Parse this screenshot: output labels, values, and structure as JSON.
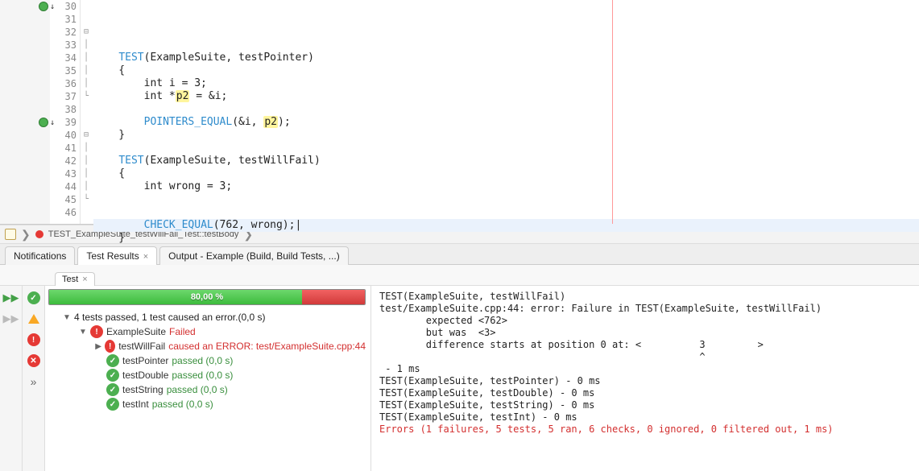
{
  "editor": {
    "lines": [
      {
        "num": 30,
        "marker": true,
        "arrow": true,
        "fold": "",
        "html": ""
      },
      {
        "num": 31,
        "fold": "",
        "segs": [
          {
            "t": "    "
          },
          {
            "t": "TEST",
            "c": "kw-macro"
          },
          {
            "t": "(ExampleSuite, testPointer)"
          }
        ]
      },
      {
        "num": 32,
        "fold": "⊟",
        "segs": [
          {
            "t": "    {"
          }
        ]
      },
      {
        "num": 33,
        "fold": "│",
        "segs": [
          {
            "t": "        int i = 3;"
          }
        ]
      },
      {
        "num": 34,
        "fold": "│",
        "segs": [
          {
            "t": "        int *"
          },
          {
            "t": "p2",
            "c": "hl-var"
          },
          {
            "t": " = &i;"
          }
        ]
      },
      {
        "num": 35,
        "fold": "│",
        "segs": [
          {
            "t": ""
          }
        ]
      },
      {
        "num": 36,
        "fold": "│",
        "segs": [
          {
            "t": "        "
          },
          {
            "t": "POINTERS_EQUAL",
            "c": "kw-macro"
          },
          {
            "t": "(&i, "
          },
          {
            "t": "p2",
            "c": "hl-var"
          },
          {
            "t": ");"
          }
        ]
      },
      {
        "num": 37,
        "fold": "└",
        "segs": [
          {
            "t": "    }"
          }
        ]
      },
      {
        "num": 38,
        "fold": "",
        "segs": [
          {
            "t": ""
          }
        ]
      },
      {
        "num": 39,
        "marker": true,
        "arrow": true,
        "fold": "",
        "segs": [
          {
            "t": "    "
          },
          {
            "t": "TEST",
            "c": "kw-macro"
          },
          {
            "t": "(ExampleSuite, testWillFail)"
          }
        ]
      },
      {
        "num": 40,
        "fold": "⊟",
        "segs": [
          {
            "t": "    {"
          }
        ]
      },
      {
        "num": 41,
        "fold": "│",
        "segs": [
          {
            "t": "        int wrong = 3;"
          }
        ]
      },
      {
        "num": 42,
        "fold": "│",
        "segs": [
          {
            "t": ""
          }
        ]
      },
      {
        "num": 43,
        "fold": "│",
        "segs": [
          {
            "t": ""
          }
        ]
      },
      {
        "num": 44,
        "fold": "│",
        "cursor": true,
        "segs": [
          {
            "t": "        "
          },
          {
            "t": "CHECK_EQUAL",
            "c": "kw-macro"
          },
          {
            "t": "(762, wrong);|"
          }
        ]
      },
      {
        "num": 45,
        "fold": "└",
        "segs": [
          {
            "t": "    }"
          }
        ]
      },
      {
        "num": 46,
        "fold": "",
        "segs": [
          {
            "t": ""
          }
        ]
      }
    ]
  },
  "breadcrumb": {
    "item": "TEST_ExampleSuite_testWillFail_Test::testBody"
  },
  "tabs": {
    "notifications": "Notifications",
    "test_results": "Test Results",
    "output": "Output - Example (Build, Build Tests, ...)"
  },
  "inner_tab": "Test",
  "progress": {
    "percent": "80,00 %",
    "green_pct": 80
  },
  "summary_line": "4 tests passed, 1 test caused an error.(0,0 s)",
  "tree": {
    "root": {
      "name": "ExampleSuite",
      "status": "Failed",
      "status_class": "st-fail"
    },
    "children": [
      {
        "name": "testWillFail",
        "status": "caused an ERROR: test/ExampleSuite.cpp:44",
        "status_class": "st-fail",
        "icon": "err",
        "tw": "▶"
      },
      {
        "name": "testPointer",
        "status": "passed  (0,0 s)",
        "status_class": "st-pass",
        "icon": "ok"
      },
      {
        "name": "testDouble",
        "status": "passed  (0,0 s)",
        "status_class": "st-pass",
        "icon": "ok"
      },
      {
        "name": "testString",
        "status": "passed  (0,0 s)",
        "status_class": "st-pass",
        "icon": "ok"
      },
      {
        "name": "testInt",
        "status": "passed  (0,0 s)",
        "status_class": "st-pass",
        "icon": "ok"
      }
    ]
  },
  "console": {
    "lines": [
      "TEST(ExampleSuite, testWillFail)",
      "test/ExampleSuite.cpp:44: error: Failure in TEST(ExampleSuite, testWillFail)",
      "        expected <762>",
      "        but was  <3>",
      "        difference starts at position 0 at: <          3         >",
      "                                                       ^",
      "",
      " - 1 ms",
      "TEST(ExampleSuite, testPointer) - 0 ms",
      "TEST(ExampleSuite, testDouble) - 0 ms",
      "TEST(ExampleSuite, testString) - 0 ms",
      "TEST(ExampleSuite, testInt) - 0 ms",
      ""
    ],
    "error_line": "Errors (1 failures, 5 tests, 5 ran, 6 checks, 0 ignored, 0 filtered out, 1 ms)"
  }
}
